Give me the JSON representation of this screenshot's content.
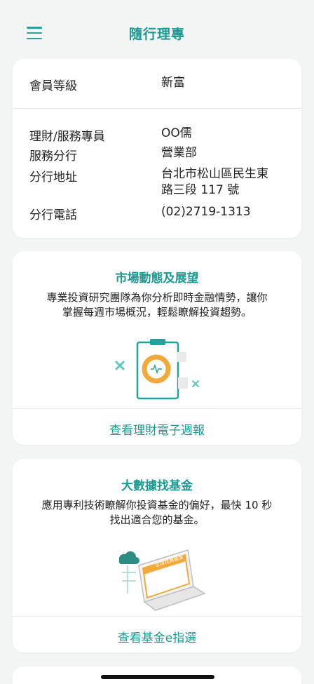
{
  "header": {
    "title": "隨行理專",
    "menu_icon": "hamburger-menu-icon"
  },
  "profile": {
    "level_label": "會員等級",
    "level_value": "新富",
    "advisor_label": "理財/服務專員",
    "advisor_value": "OO儒",
    "branch_label": "服務分行",
    "branch_value": "營業部",
    "address_label": "分行地址",
    "address_line1": "台北市松山區民生東",
    "address_line2": "路三段 117 號",
    "phone_label": "分行電話",
    "phone_value": "(02)2719-1313"
  },
  "market": {
    "title": "市場動態及展望",
    "desc_line1": "專業投資研究團隊為你分析即時金融情勢，讓你",
    "desc_line2": "掌握每週市場概況，輕鬆瞭解投資趨勢。",
    "link": "查看理財電子週報",
    "illustration": "clipboard-report-illustration"
  },
  "fund": {
    "title": "大數據找基金",
    "desc_line1": "應用專利技術瞭解你投資基金的偏好，最快 10 秒",
    "desc_line2": "找出適合您的基金。",
    "link": "查看基金e指選",
    "laptop_screen_text": "全球找資基金",
    "illustration": "laptop-cloud-illustration"
  },
  "colors": {
    "accent": "#1a9a91",
    "background": "#f3f4f4",
    "card": "#ffffff"
  }
}
